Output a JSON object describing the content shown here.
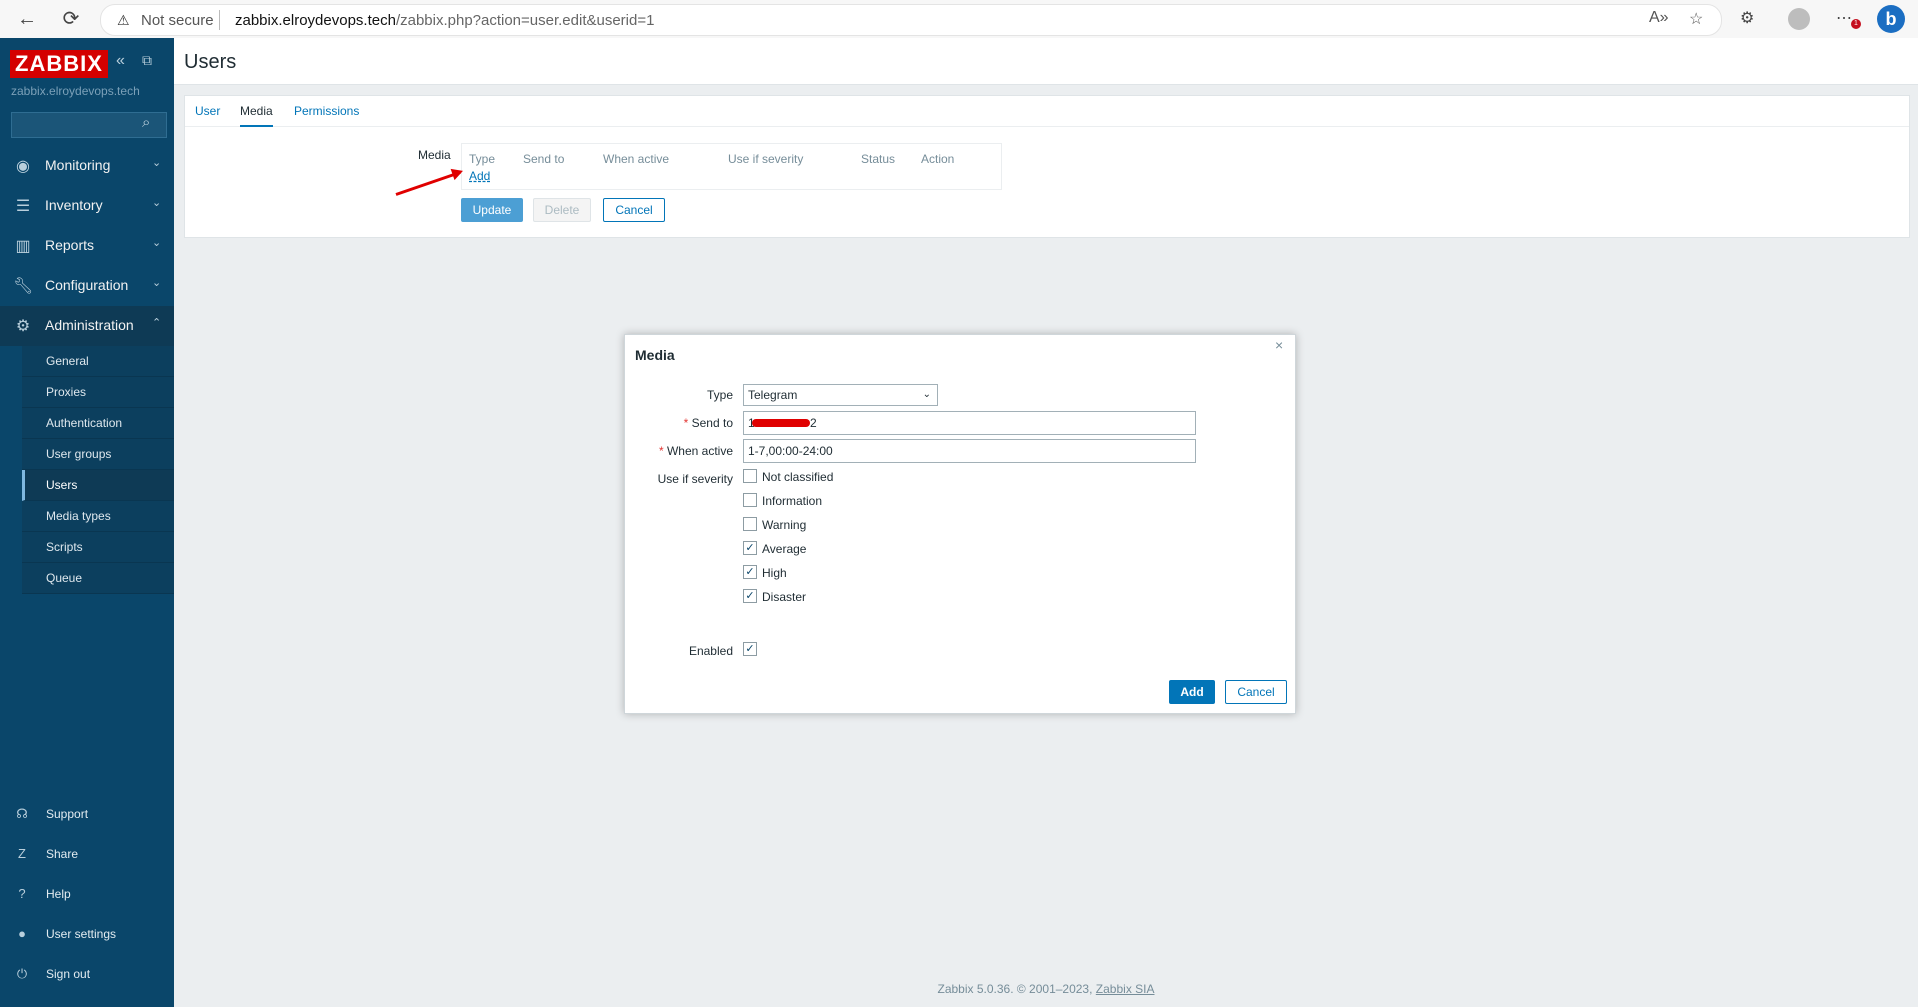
{
  "browser": {
    "security_label": "Not secure",
    "url_host": "zabbix.elroydevops.tech",
    "url_path": "/zabbix.php?action=user.edit&userid=1"
  },
  "sidebar": {
    "logo": "ZABBIX",
    "server_name": "zabbix.elroydevops.tech",
    "search_placeholder": "",
    "menu": [
      {
        "label": "Monitoring",
        "icon": "eye-icon"
      },
      {
        "label": "Inventory",
        "icon": "list-icon"
      },
      {
        "label": "Reports",
        "icon": "bar-chart-icon"
      },
      {
        "label": "Configuration",
        "icon": "wrench-icon"
      },
      {
        "label": "Administration",
        "icon": "gear-icon"
      }
    ],
    "admin_submenu": [
      "General",
      "Proxies",
      "Authentication",
      "User groups",
      "Users",
      "Media types",
      "Scripts",
      "Queue"
    ],
    "bottom": [
      {
        "label": "Support",
        "icon": "headset-icon"
      },
      {
        "label": "Share",
        "icon": "share-icon"
      },
      {
        "label": "Help",
        "icon": "question-icon"
      },
      {
        "label": "User settings",
        "icon": "user-icon"
      },
      {
        "label": "Sign out",
        "icon": "power-icon"
      }
    ]
  },
  "page": {
    "title": "Users",
    "tabs": [
      "User",
      "Media",
      "Permissions"
    ],
    "active_tab": "Media",
    "media_label": "Media",
    "media_columns": [
      "Type",
      "Send to",
      "When active",
      "Use if severity",
      "Status",
      "Action"
    ],
    "add_link": "Add",
    "buttons": {
      "update": "Update",
      "delete": "Delete",
      "cancel": "Cancel"
    }
  },
  "modal": {
    "title": "Media",
    "type_label": "Type",
    "type_value": "Telegram",
    "send_to_label": "Send to",
    "send_to_value_visible_start": "1",
    "send_to_value_visible_end": "2",
    "when_active_label": "When active",
    "when_active_value": "1-7,00:00-24:00",
    "severity_label": "Use if severity",
    "severities": [
      {
        "label": "Not classified",
        "checked": false
      },
      {
        "label": "Information",
        "checked": false
      },
      {
        "label": "Warning",
        "checked": false
      },
      {
        "label": "Average",
        "checked": true
      },
      {
        "label": "High",
        "checked": true
      },
      {
        "label": "Disaster",
        "checked": true
      }
    ],
    "enabled_label": "Enabled",
    "enabled": true,
    "add_button": "Add",
    "cancel_button": "Cancel"
  },
  "footer": {
    "text": "Zabbix 5.0.36. © 2001–2023,",
    "link": "Zabbix SIA"
  },
  "colors": {
    "sidebar": "#0a466a",
    "accent": "#0275b8",
    "annotation_arrow": "#e00000",
    "logo_bg": "#d40000"
  }
}
